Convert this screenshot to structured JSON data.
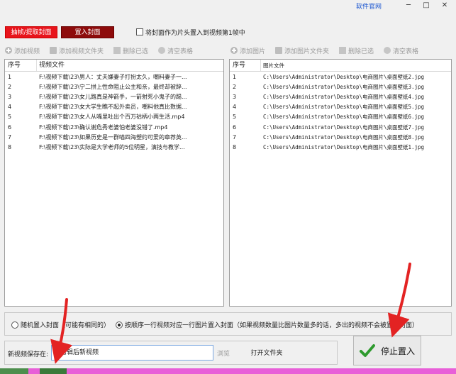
{
  "titlebar": {
    "official_site": "软件官网",
    "minimize": "─",
    "maximize": "□",
    "close": "✕"
  },
  "tabs": [
    {
      "label": "抽帧/提取封面"
    },
    {
      "label": "置入封面"
    }
  ],
  "option_checkbox": {
    "label": "将封面作为片头置入到视频第1帧中",
    "checked": false
  },
  "left_toolbar": [
    {
      "label": "添加视频",
      "icon": "add-icon"
    },
    {
      "label": "添加视频文件夹",
      "icon": "folder-icon"
    },
    {
      "label": "删除已选",
      "icon": "delete-icon"
    },
    {
      "label": "清空表格",
      "icon": "clear-icon"
    }
  ],
  "right_toolbar": [
    {
      "label": "添加图片",
      "icon": "add-icon"
    },
    {
      "label": "添加图片文件夹",
      "icon": "folder-icon"
    },
    {
      "label": "删除已选",
      "icon": "delete-icon"
    },
    {
      "label": "清空表格",
      "icon": "clear-icon"
    }
  ],
  "video_table": {
    "headers": [
      "序号",
      "视频文件"
    ],
    "rows": [
      [
        "1",
        "F:\\视频下载\\23\\男人：丈夫嫌妻子打扮太久，嘲料妻子一..."
      ],
      [
        "2",
        "F:\\视频下载\\23\\宁二拼上性命阻止公主和亲，最终却被辞..."
      ],
      [
        "3",
        "F:\\视频下载\\23\\女儿路真是神箭手，一箭射死小鬼子的踢..."
      ],
      [
        "4",
        "F:\\视频下载\\23\\女大学生瞧不起外卖员，嘲料他真比数据..."
      ],
      [
        "5",
        "F:\\视频下载\\23\\女人从嘴里吐出个百万祜柄小两生活.mp4"
      ],
      [
        "6",
        "F:\\视频下载\\23\\确认谢危秀老婆怕老婆没错了.mp4"
      ],
      [
        "7",
        "F:\\视频下载\\23\\如果历史是一群喵四海塑约可爱的章荐英..."
      ],
      [
        "8",
        "F:\\视频下载\\23\\实际是大学老师的5位明星，演技与教学..."
      ]
    ]
  },
  "image_table": {
    "headers": [
      "序号",
      "图片文件"
    ],
    "rows": [
      [
        "1",
        "C:\\Users\\Administrator\\Desktop\\电商图片\\桌面壁纸2.jpg"
      ],
      [
        "2",
        "C:\\Users\\Administrator\\Desktop\\电商图片\\桌面壁纸3.jpg"
      ],
      [
        "3",
        "C:\\Users\\Administrator\\Desktop\\电商图片\\桌面壁纸4.jpg"
      ],
      [
        "4",
        "C:\\Users\\Administrator\\Desktop\\电商图片\\桌面壁纸5.jpg"
      ],
      [
        "5",
        "C:\\Users\\Administrator\\Desktop\\电商图片\\桌面壁纸6.jpg"
      ],
      [
        "6",
        "C:\\Users\\Administrator\\Desktop\\电商图片\\桌面壁纸7.jpg"
      ],
      [
        "7",
        "C:\\Users\\Administrator\\Desktop\\电商图片\\桌面壁纸8.jpg"
      ],
      [
        "8",
        "C:\\Users\\Administrator\\Desktop\\电商图片\\桌面壁纸1.jpg"
      ]
    ]
  },
  "mode_options": [
    {
      "label": "随机置入封面（可能有相同的）",
      "selected": false
    },
    {
      "label": "按顺序一行视频对应一行图片置入封面（如果视频数量比图片数量多的话，多出的视频不会被置入封面）",
      "selected": true
    }
  ],
  "save": {
    "label": "新视频保存在:",
    "value": "原剪辑后新视频",
    "browse": "浏览",
    "open_folder": "打开文件夹"
  },
  "stop_button": {
    "label": "停止置入"
  },
  "colors": {
    "accent_red": "#e8141c",
    "dark_red": "#8e0b0b",
    "link_blue": "#1a55d0",
    "annotation_red": "#e32323",
    "check_green": "#2e9a2e"
  }
}
